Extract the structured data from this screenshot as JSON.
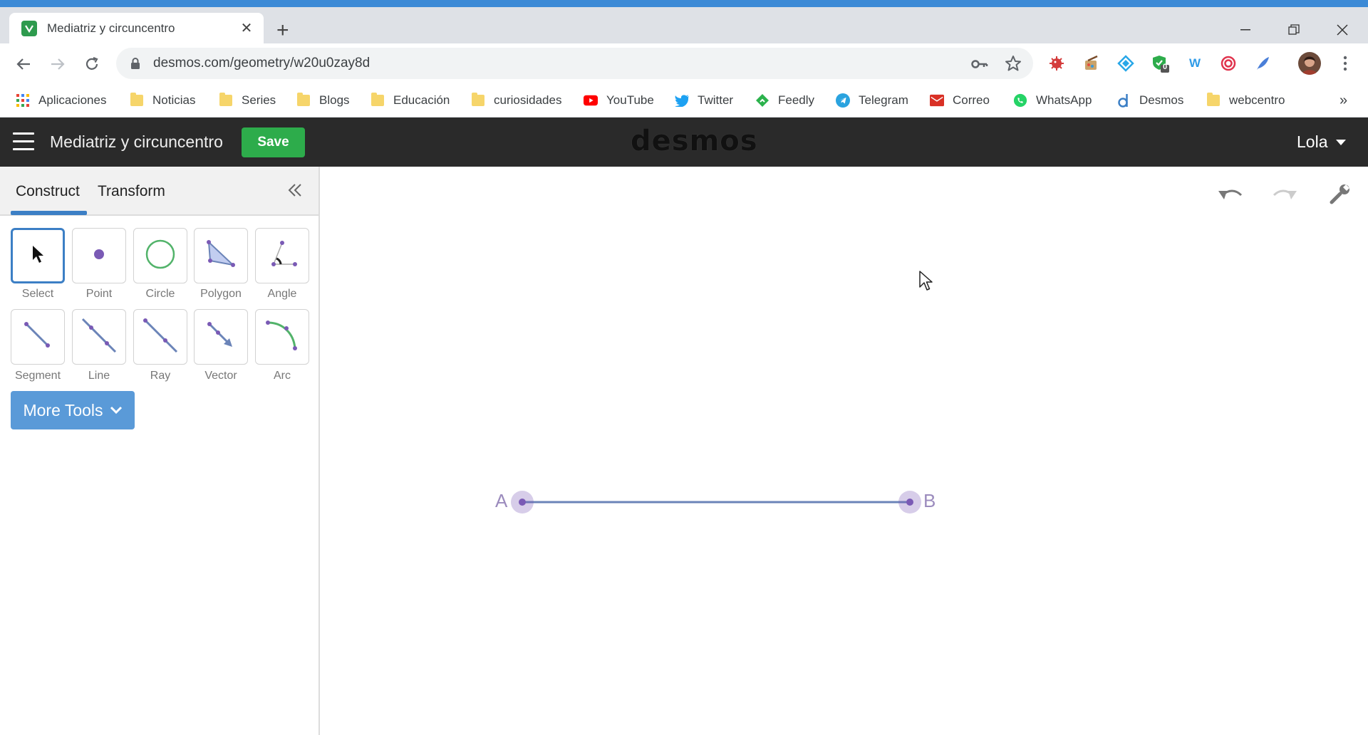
{
  "browser": {
    "tab_title": "Mediatriz y circuncentro",
    "url": "desmos.com/geometry/w20u0zay8d",
    "extension_badge": "0",
    "bookmarks": [
      {
        "label": "Aplicaciones",
        "icon": "apps-grid-icon"
      },
      {
        "label": "Noticias",
        "icon": "folder-icon"
      },
      {
        "label": "Series",
        "icon": "folder-icon"
      },
      {
        "label": "Blogs",
        "icon": "folder-icon"
      },
      {
        "label": "Educación",
        "icon": "folder-icon"
      },
      {
        "label": "curiosidades",
        "icon": "folder-icon"
      },
      {
        "label": "YouTube",
        "icon": "youtube-icon"
      },
      {
        "label": "Twitter",
        "icon": "twitter-icon"
      },
      {
        "label": "Feedly",
        "icon": "feedly-icon"
      },
      {
        "label": "Telegram",
        "icon": "telegram-icon"
      },
      {
        "label": "Correo",
        "icon": "mail-icon"
      },
      {
        "label": "WhatsApp",
        "icon": "whatsapp-icon"
      },
      {
        "label": "Desmos",
        "icon": "desmos-icon"
      },
      {
        "label": "webcentro",
        "icon": "folder-icon"
      }
    ],
    "overflow": "»"
  },
  "app": {
    "title": "Mediatriz y circuncentro",
    "save_label": "Save",
    "brand": "desmos",
    "user": "Lola"
  },
  "panel": {
    "tabs": [
      "Construct",
      "Transform"
    ],
    "active_tab": "Construct",
    "tools": [
      {
        "label": "Select",
        "icon": "select-arrow-icon"
      },
      {
        "label": "Point",
        "icon": "point-icon"
      },
      {
        "label": "Circle",
        "icon": "circle-icon"
      },
      {
        "label": "Polygon",
        "icon": "polygon-icon"
      },
      {
        "label": "Angle",
        "icon": "angle-icon"
      },
      {
        "label": "Segment",
        "icon": "segment-icon"
      },
      {
        "label": "Line",
        "icon": "line-icon"
      },
      {
        "label": "Ray",
        "icon": "ray-icon"
      },
      {
        "label": "Vector",
        "icon": "vector-icon"
      },
      {
        "label": "Arc",
        "icon": "arc-icon"
      }
    ],
    "active_tool": "Select",
    "more_tools_label": "More Tools"
  },
  "canvas": {
    "points": [
      {
        "label": "A"
      },
      {
        "label": "B"
      }
    ],
    "segment": "AB"
  },
  "colors": {
    "chrome_strip": "#3c8ad6",
    "desmos_header": "#2a2a2a",
    "save_green": "#2dac4b",
    "accent_blue": "#3c7fc5",
    "more_tools_blue": "#5a9ad8",
    "geometry_purple": "#7a5ab5",
    "segment_blue": "#6b84b8"
  }
}
